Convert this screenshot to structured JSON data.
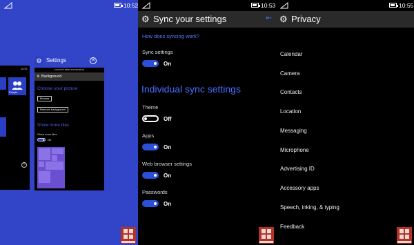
{
  "task_switcher": {
    "status_time": "10:52",
    "left_card": {
      "mini_status": "10:51",
      "people_label": "People"
    },
    "right_card": {
      "app_title": "Settings",
      "mini_header": "couldn't take screenshot",
      "band_title": "Background",
      "choose_heading": "Choose your picture",
      "browse_label": "Browse",
      "remove_label": "Remove background",
      "more_tiles_heading": "Show more tiles",
      "more_tiles_label": "Show more tiles",
      "on_label": "On"
    }
  },
  "sync_screen": {
    "status_time": "10:53",
    "title": "Sync your settings",
    "link": "How does syncing work?",
    "sync_settings": {
      "label": "Sync settings",
      "state": "On"
    },
    "section_title": "Individual sync settings",
    "items": [
      {
        "label": "Theme",
        "state": "Off"
      },
      {
        "label": "Apps",
        "state": "On"
      },
      {
        "label": "Web browser settings",
        "state": "On"
      },
      {
        "label": "Passwords",
        "state": "On"
      }
    ]
  },
  "privacy_screen": {
    "status_time": "10:55",
    "title": "Privacy",
    "items": [
      "Calendar",
      "Camera",
      "Contacts",
      "Location",
      "Messaging",
      "Microphone",
      "Advertising ID",
      "Accessory apps",
      "Speech, inking, & typing",
      "Feedback"
    ]
  },
  "icons": {
    "gear": "gear-icon",
    "close": "close-icon",
    "pin": "pin-icon",
    "watermark": "windows-logo-icon"
  },
  "colors": {
    "accent": "#2b4fd8",
    "switcher_bg": "#3244c8",
    "header_bg": "#2a2a2a",
    "link": "#5a7cff"
  }
}
